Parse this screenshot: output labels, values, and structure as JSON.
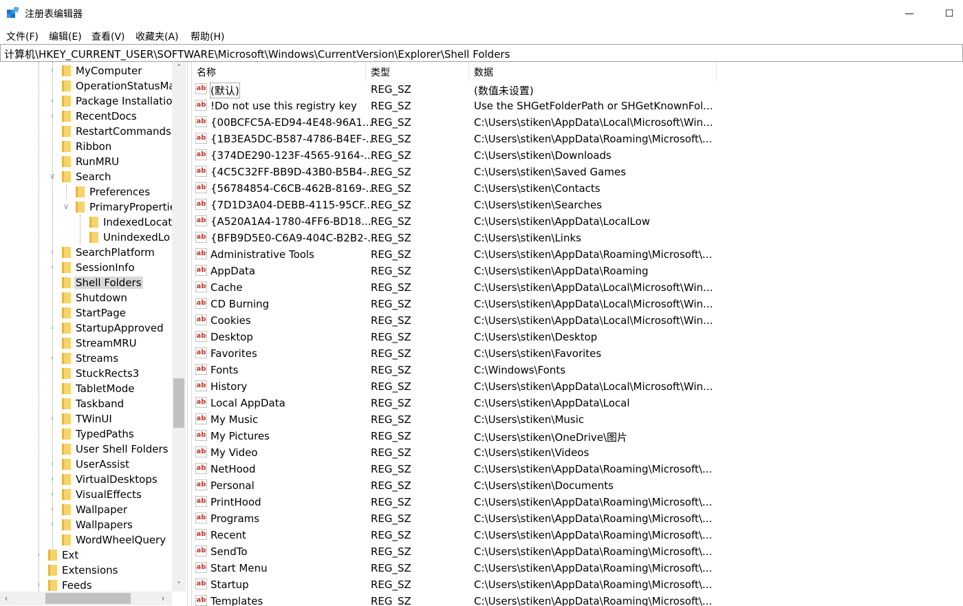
{
  "window": {
    "title": "注册表编辑器",
    "minimize_label": "—",
    "maximize_label": "☐"
  },
  "menu": [
    "文件(F)",
    "编辑(E)",
    "查看(V)",
    "收藏夹(A)",
    "帮助(H)"
  ],
  "address": "计算机\\HKEY_CURRENT_USER\\SOFTWARE\\Microsoft\\Windows\\CurrentVersion\\Explorer\\Shell Folders",
  "tree": {
    "items": [
      {
        "label": "MyComputer",
        "depth": 1,
        "expander": "collapsed"
      },
      {
        "label": "OperationStatusMa",
        "depth": 1,
        "expander": "none"
      },
      {
        "label": "Package Installation",
        "depth": 1,
        "expander": "collapsed"
      },
      {
        "label": "RecentDocs",
        "depth": 1,
        "expander": "collapsed"
      },
      {
        "label": "RestartCommands",
        "depth": 1,
        "expander": "none"
      },
      {
        "label": "Ribbon",
        "depth": 1,
        "expander": "none"
      },
      {
        "label": "RunMRU",
        "depth": 1,
        "expander": "none"
      },
      {
        "label": "Search",
        "depth": 1,
        "expander": "expanded"
      },
      {
        "label": "Preferences",
        "depth": 2,
        "expander": "none"
      },
      {
        "label": "PrimaryProperties",
        "depth": 2,
        "expander": "expanded"
      },
      {
        "label": "IndexedLocat",
        "depth": 3,
        "expander": "none"
      },
      {
        "label": "UnindexedLo",
        "depth": 3,
        "expander": "none"
      },
      {
        "label": "SearchPlatform",
        "depth": 1,
        "expander": "collapsed"
      },
      {
        "label": "SessionInfo",
        "depth": 1,
        "expander": "collapsed"
      },
      {
        "label": "Shell Folders",
        "depth": 1,
        "expander": "none",
        "selected": true
      },
      {
        "label": "Shutdown",
        "depth": 1,
        "expander": "none"
      },
      {
        "label": "StartPage",
        "depth": 1,
        "expander": "none"
      },
      {
        "label": "StartupApproved",
        "depth": 1,
        "expander": "collapsed"
      },
      {
        "label": "StreamMRU",
        "depth": 1,
        "expander": "none"
      },
      {
        "label": "Streams",
        "depth": 1,
        "expander": "collapsed"
      },
      {
        "label": "StuckRects3",
        "depth": 1,
        "expander": "none"
      },
      {
        "label": "TabletMode",
        "depth": 1,
        "expander": "none"
      },
      {
        "label": "Taskband",
        "depth": 1,
        "expander": "none"
      },
      {
        "label": "TWinUI",
        "depth": 1,
        "expander": "collapsed"
      },
      {
        "label": "TypedPaths",
        "depth": 1,
        "expander": "none"
      },
      {
        "label": "User Shell Folders",
        "depth": 1,
        "expander": "none"
      },
      {
        "label": "UserAssist",
        "depth": 1,
        "expander": "collapsed"
      },
      {
        "label": "VirtualDesktops",
        "depth": 1,
        "expander": "collapsed"
      },
      {
        "label": "VisualEffects",
        "depth": 1,
        "expander": "collapsed"
      },
      {
        "label": "Wallpaper",
        "depth": 1,
        "expander": "collapsed"
      },
      {
        "label": "Wallpapers",
        "depth": 1,
        "expander": "collapsed"
      },
      {
        "label": "WordWheelQuery",
        "depth": 1,
        "expander": "none"
      },
      {
        "label": "Ext",
        "depth": 0,
        "expander": "collapsed"
      },
      {
        "label": "Extensions",
        "depth": 0,
        "expander": "none"
      },
      {
        "label": "Feeds",
        "depth": 0,
        "expander": "collapsed"
      }
    ]
  },
  "list": {
    "headers": {
      "name": "名称",
      "type": "类型",
      "data": "数据"
    },
    "icon_text": "ab",
    "rows": [
      {
        "name": "(默认)",
        "type": "REG_SZ",
        "data": "(数值未设置)"
      },
      {
        "name": "!Do not use this registry key",
        "type": "REG_SZ",
        "data": "Use the SHGetFolderPath or SHGetKnownFol..."
      },
      {
        "name": "{00BCFC5A-ED94-4E48-96A1...",
        "type": "REG_SZ",
        "data": "C:\\Users\\stiken\\AppData\\Local\\Microsoft\\Win..."
      },
      {
        "name": "{1B3EA5DC-B587-4786-B4EF-...",
        "type": "REG_SZ",
        "data": "C:\\Users\\stiken\\AppData\\Roaming\\Microsoft\\..."
      },
      {
        "name": "{374DE290-123F-4565-9164-...",
        "type": "REG_SZ",
        "data": "C:\\Users\\stiken\\Downloads"
      },
      {
        "name": "{4C5C32FF-BB9D-43B0-B5B4-...",
        "type": "REG_SZ",
        "data": "C:\\Users\\stiken\\Saved Games"
      },
      {
        "name": "{56784854-C6CB-462B-8169-...",
        "type": "REG_SZ",
        "data": "C:\\Users\\stiken\\Contacts"
      },
      {
        "name": "{7D1D3A04-DEBB-4115-95CF...",
        "type": "REG_SZ",
        "data": "C:\\Users\\stiken\\Searches"
      },
      {
        "name": "{A520A1A4-1780-4FF6-BD18...",
        "type": "REG_SZ",
        "data": "C:\\Users\\stiken\\AppData\\LocalLow"
      },
      {
        "name": "{BFB9D5E0-C6A9-404C-B2B2-...",
        "type": "REG_SZ",
        "data": "C:\\Users\\stiken\\Links"
      },
      {
        "name": "Administrative Tools",
        "type": "REG_SZ",
        "data": "C:\\Users\\stiken\\AppData\\Roaming\\Microsoft\\..."
      },
      {
        "name": "AppData",
        "type": "REG_SZ",
        "data": "C:\\Users\\stiken\\AppData\\Roaming"
      },
      {
        "name": "Cache",
        "type": "REG_SZ",
        "data": "C:\\Users\\stiken\\AppData\\Local\\Microsoft\\Win..."
      },
      {
        "name": "CD Burning",
        "type": "REG_SZ",
        "data": "C:\\Users\\stiken\\AppData\\Local\\Microsoft\\Win..."
      },
      {
        "name": "Cookies",
        "type": "REG_SZ",
        "data": "C:\\Users\\stiken\\AppData\\Local\\Microsoft\\Win..."
      },
      {
        "name": "Desktop",
        "type": "REG_SZ",
        "data": "C:\\Users\\stiken\\Desktop"
      },
      {
        "name": "Favorites",
        "type": "REG_SZ",
        "data": "C:\\Users\\stiken\\Favorites"
      },
      {
        "name": "Fonts",
        "type": "REG_SZ",
        "data": "C:\\Windows\\Fonts"
      },
      {
        "name": "History",
        "type": "REG_SZ",
        "data": "C:\\Users\\stiken\\AppData\\Local\\Microsoft\\Win..."
      },
      {
        "name": "Local AppData",
        "type": "REG_SZ",
        "data": "C:\\Users\\stiken\\AppData\\Local"
      },
      {
        "name": "My Music",
        "type": "REG_SZ",
        "data": "C:\\Users\\stiken\\Music"
      },
      {
        "name": "My Pictures",
        "type": "REG_SZ",
        "data": "C:\\Users\\stiken\\OneDrive\\图片"
      },
      {
        "name": "My Video",
        "type": "REG_SZ",
        "data": "C:\\Users\\stiken\\Videos"
      },
      {
        "name": "NetHood",
        "type": "REG_SZ",
        "data": "C:\\Users\\stiken\\AppData\\Roaming\\Microsoft\\..."
      },
      {
        "name": "Personal",
        "type": "REG_SZ",
        "data": "C:\\Users\\stiken\\Documents"
      },
      {
        "name": "PrintHood",
        "type": "REG_SZ",
        "data": "C:\\Users\\stiken\\AppData\\Roaming\\Microsoft\\..."
      },
      {
        "name": "Programs",
        "type": "REG_SZ",
        "data": "C:\\Users\\stiken\\AppData\\Roaming\\Microsoft\\..."
      },
      {
        "name": "Recent",
        "type": "REG_SZ",
        "data": "C:\\Users\\stiken\\AppData\\Roaming\\Microsoft\\..."
      },
      {
        "name": "SendTo",
        "type": "REG_SZ",
        "data": "C:\\Users\\stiken\\AppData\\Roaming\\Microsoft\\..."
      },
      {
        "name": "Start Menu",
        "type": "REG_SZ",
        "data": "C:\\Users\\stiken\\AppData\\Roaming\\Microsoft\\..."
      },
      {
        "name": "Startup",
        "type": "REG_SZ",
        "data": "C:\\Users\\stiken\\AppData\\Roaming\\Microsoft\\..."
      },
      {
        "name": "Templates",
        "type": "REG_SZ",
        "data": "C:\\Users\\stiken\\AppData\\Roaming\\Microsoft\\..."
      }
    ]
  },
  "colors": {
    "folder": "#f6d36b",
    "selection": "#d9d9d9",
    "icon_red": "#c0392b",
    "scroll_thumb": "#c1c1c1"
  },
  "icons": {
    "app": "registry-editor-icon",
    "folder": "folder-icon",
    "value": "string-value-icon"
  }
}
